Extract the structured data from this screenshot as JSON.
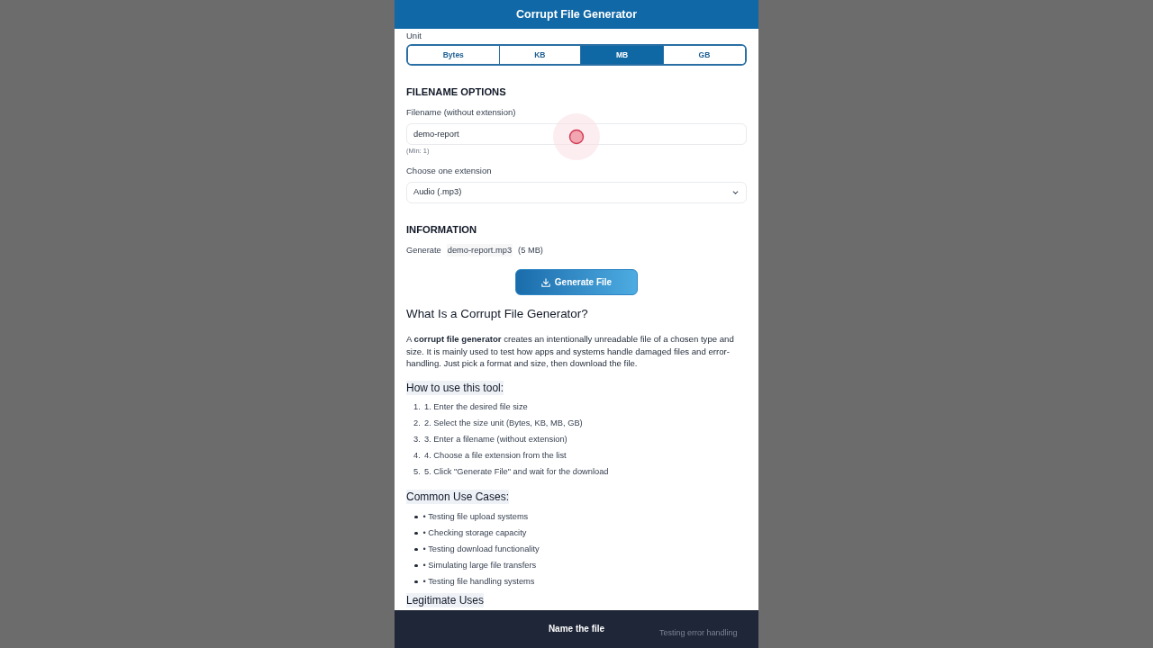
{
  "header": {
    "title": "Corrupt File Generator"
  },
  "unit": {
    "label": "Unit",
    "options": [
      {
        "label": "Bytes",
        "selected": false
      },
      {
        "label": "KB",
        "selected": false
      },
      {
        "label": "MB",
        "selected": true
      },
      {
        "label": "GB",
        "selected": false
      }
    ]
  },
  "filename_options": {
    "heading": "FILENAME OPTIONS",
    "filename_label": "Filename (without extension)",
    "filename_value": "demo-report",
    "filename_hint": "(Min: 1)",
    "extension_label": "Choose one extension",
    "extension_value": "Audio (.mp3)"
  },
  "information": {
    "heading": "INFORMATION",
    "prefix": "Generate",
    "filename": "demo-report.mp3",
    "size": "(5 MB)"
  },
  "generate_button": {
    "label": "Generate File"
  },
  "article": {
    "title": "What Is a Corrupt File Generator?",
    "intro": "A **corrupt file generator** creates an intentionally unreadable file of a chosen type and size. It is mainly used to test how apps and systems handle damaged files and error-handling. Just pick a format and size, then download the file.",
    "sections": [
      {
        "heading": "How to use this tool:",
        "kind": "numbered",
        "items": [
          {
            "marker": "1.",
            "text": "1. Enter the desired file size"
          },
          {
            "marker": "2.",
            "text": "2. Select the size unit (Bytes, KB, MB, GB)"
          },
          {
            "marker": "3.",
            "text": "3. Enter a filename (without extension)"
          },
          {
            "marker": "4.",
            "text": "4. Choose a file extension from the list"
          },
          {
            "marker": "5.",
            "text": "5. Click \"Generate File\" and wait for the download"
          }
        ]
      },
      {
        "heading": "Common Use Cases:",
        "kind": "bulleted",
        "items": [
          {
            "text": "• Testing file upload systems"
          },
          {
            "text": "• Checking storage capacity"
          },
          {
            "text": "• Testing download functionality"
          },
          {
            "text": "• Simulating large file transfers"
          },
          {
            "text": "• Testing file handling systems"
          }
        ]
      },
      {
        "heading": "Legitimate Uses"
      }
    ]
  },
  "caption": {
    "title": "Name the file",
    "background_text": "Testing error handling"
  }
}
